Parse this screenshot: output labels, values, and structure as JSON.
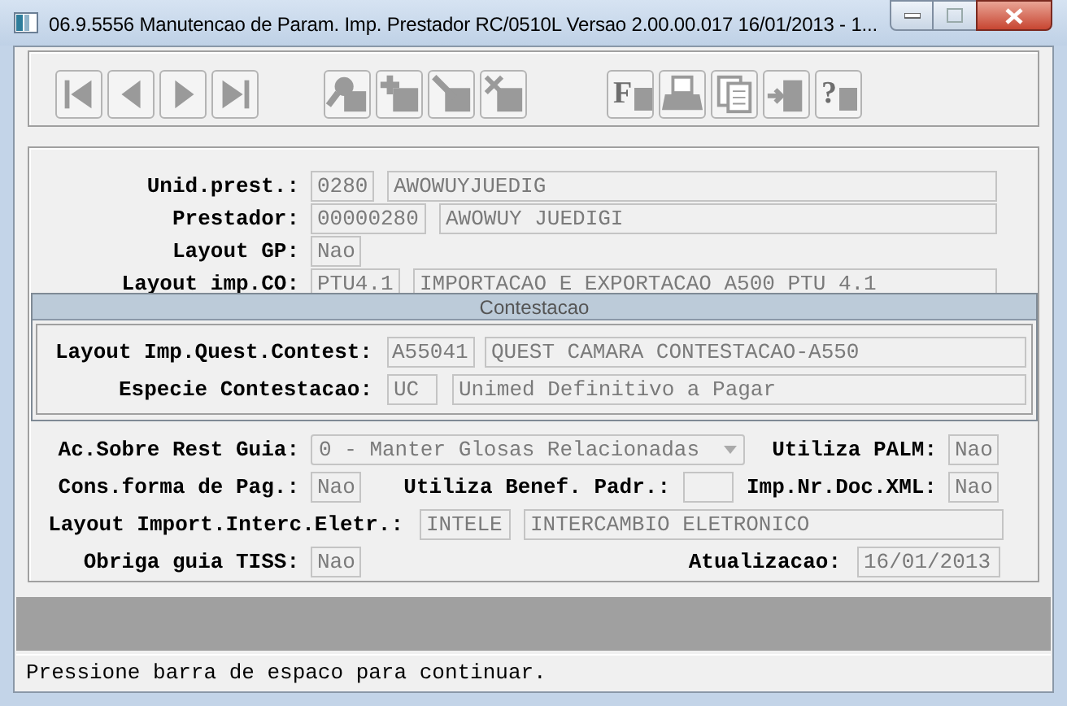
{
  "window": {
    "title": "06.9.5556 Manutencao  de Param. Imp. Prestador RC/0510L Versao 2.00.00.017 16/01/2013 - 1..."
  },
  "toolbar": [
    {
      "kind": "first"
    },
    {
      "kind": "prev"
    },
    {
      "kind": "next"
    },
    {
      "kind": "last"
    },
    {
      "kind": "search"
    },
    {
      "kind": "add"
    },
    {
      "kind": "edit"
    },
    {
      "kind": "delete"
    },
    {
      "kind": "letter",
      "glyph": "F"
    },
    {
      "kind": "print"
    },
    {
      "kind": "copy"
    },
    {
      "kind": "exit"
    },
    {
      "kind": "letter",
      "glyph": "?"
    }
  ],
  "unid_prest": {
    "label": "Unid.prest.:",
    "code": "0280",
    "name": "AWOWUYJUEDIG"
  },
  "prestador": {
    "label": "Prestador:",
    "code": "00000280",
    "name": "AWOWUY JUEDIGI"
  },
  "layout_gp": {
    "label": "Layout GP:",
    "value": "Nao"
  },
  "layout_imp_co": {
    "label": "Layout imp.CO:",
    "code": "PTU4.1",
    "name": "IMPORTACAO E EXPORTACAO A500 PTU 4.1"
  },
  "contestacao": {
    "title": "Contestacao",
    "layout_imp_quest_contest": {
      "label": "Layout Imp.Quest.Contest:",
      "code": "A55041",
      "name": "QUEST CAMARA CONTESTACAO-A550"
    },
    "especie_contestacao": {
      "label": "Especie Contestacao:",
      "code": "UC",
      "name": "Unimed Definitivo a Pagar"
    }
  },
  "ac_sobre_rest_guia": {
    "label": "Ac.Sobre Rest Guia:",
    "value": "0 - Manter Glosas Relacionadas"
  },
  "utiliza_palm": {
    "label": "Utiliza PALM:",
    "value": "Nao"
  },
  "cons_forma_de_pag": {
    "label": "Cons.forma de Pag.:",
    "value": "Nao"
  },
  "utiliza_benef_padr": {
    "label": "Utiliza Benef. Padr.:"
  },
  "imp_nr_doc_xml": {
    "label": "Imp.Nr.Doc.XML:",
    "value": "Nao"
  },
  "layout_import_interc_eletr": {
    "label": "Layout Import.Interc.Eletr.:",
    "code": "INTELE",
    "name": "INTERCAMBIO ELETRONICO"
  },
  "obriga_guia_tiss": {
    "label": "Obriga guia TISS:",
    "value": "Nao"
  },
  "atualizacao": {
    "label": "Atualizacao:",
    "value": "16/01/2013"
  },
  "status_bar": {
    "message": "Pressione barra de espaco para continuar."
  }
}
